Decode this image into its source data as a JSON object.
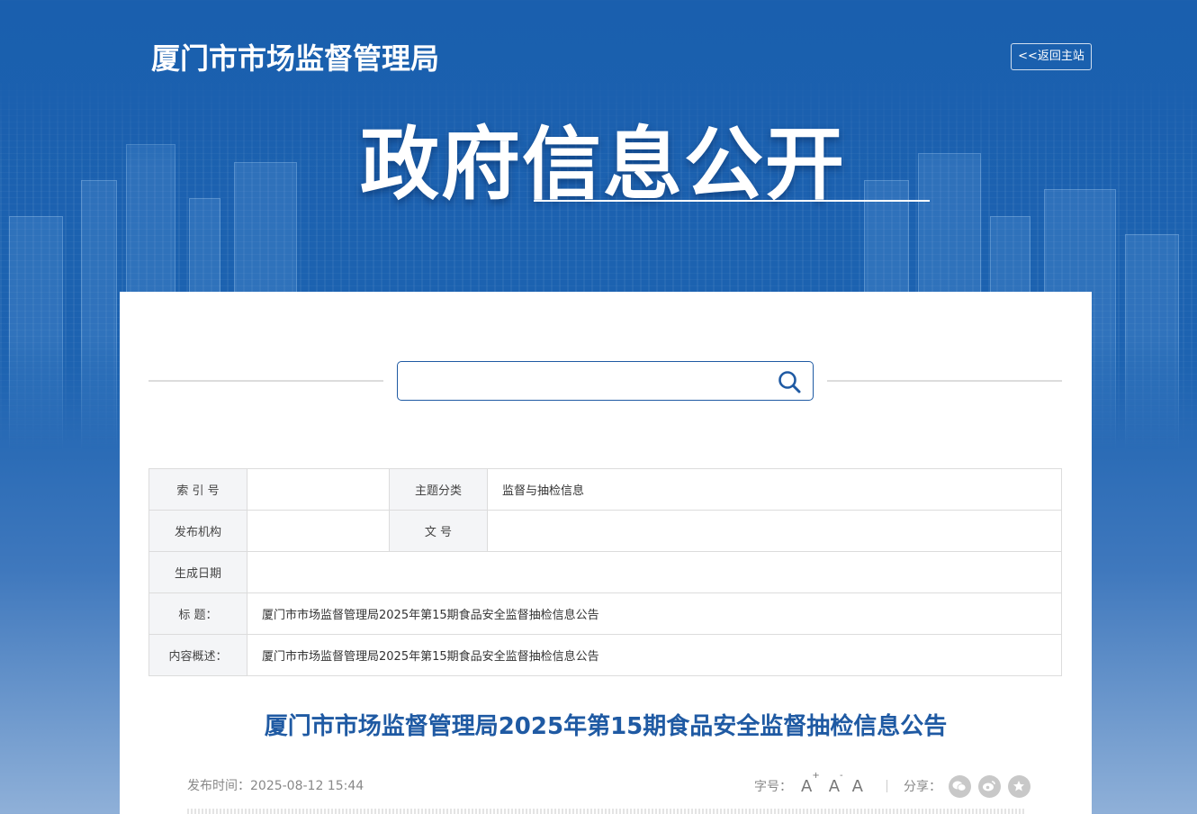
{
  "header": {
    "site_title": "厦门市市场监督管理局",
    "home_button": "<<返回主站",
    "banner_title": "政府信息公开"
  },
  "search": {
    "placeholder": "",
    "icon": "search-icon"
  },
  "meta": {
    "index_label": "索 引 号",
    "index_value": "",
    "topic_label": "主题分类",
    "topic_value": "监督与抽检信息",
    "publisher_label": "发布机构",
    "publisher_value": "",
    "docno_label": "文 号",
    "docno_value": "",
    "date_label": "生成日期",
    "date_value": "",
    "title_label": "标 题：",
    "title_value": "厦门市市场监督管理局2025年第15期食品安全监督抽检信息公告",
    "summary_label": "内容概述：",
    "summary_value": "厦门市市场监督管理局2025年第15期食品安全监督抽检信息公告"
  },
  "article": {
    "title": "厦门市市场监督管理局2025年第15期食品安全监督抽检信息公告",
    "publish_time": "发布时间：2025-08-12 15:44",
    "font_size_label": "字号：",
    "font_large": "A",
    "font_small": "A",
    "font_normal": "A",
    "share_label": "分享："
  },
  "colors": {
    "brand_blue": "#1f5aa3",
    "background_blue": "#1a5fae"
  }
}
